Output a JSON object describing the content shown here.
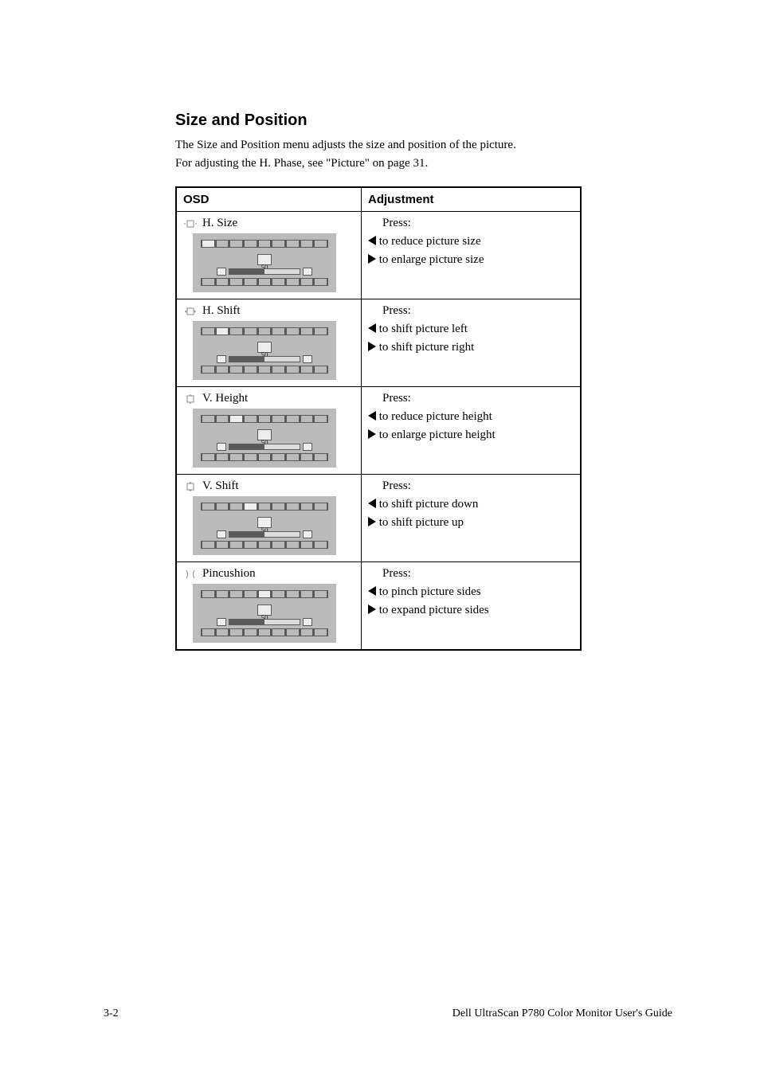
{
  "title": "Size and Position",
  "intro1": "The Size and Position menu adjusts the size and position of the picture.",
  "intro2_a": "For adjusting the H. Phase, see ",
  "intro2_link": "\"Picture\" on page 31",
  "intro2_b": ".",
  "table": {
    "header_osd": "OSD",
    "header_adj": "Adjustment",
    "rows": [
      {
        "id": "hsize",
        "icon": "hsize-icon",
        "name": "H. Size",
        "value": "50",
        "left": "to reduce picture size",
        "right": "to enlarge picture size"
      },
      {
        "id": "hshift",
        "icon": "hshift-icon",
        "name": "H. Shift",
        "value": "50",
        "left": "to shift picture left",
        "right": "to shift picture right"
      },
      {
        "id": "vheight",
        "icon": "vheight-icon",
        "name": "V. Height",
        "value": "50",
        "left": "to reduce picture height",
        "right": "to enlarge picture height"
      },
      {
        "id": "vshift",
        "icon": "vshift-icon",
        "name": "V. Shift",
        "value": "50",
        "left": "to shift picture down",
        "right": "to shift picture up"
      },
      {
        "id": "pincushion",
        "icon": "pincushion-icon",
        "name": "Pincushion",
        "value": "50",
        "left": "to pinch picture sides",
        "right": "to expand picture sides"
      }
    ]
  },
  "footer_left": "3-2",
  "footer_right": "Dell UltraScan P780 Color Monitor User's Guide"
}
